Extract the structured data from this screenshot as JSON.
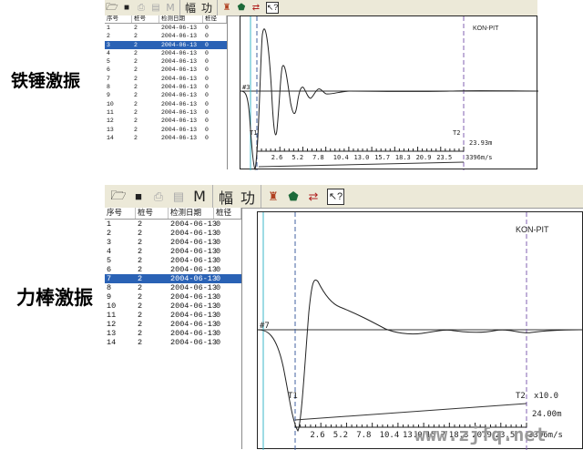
{
  "panels": [
    {
      "caption": "铁锤激振",
      "toolbar": {
        "open_icon": "open-folder-icon",
        "save_icon": "save-disk-icon",
        "print_icon": "print-icon",
        "preview_icon": "print-preview-icon",
        "m_label": "M",
        "fu_label": "幅",
        "gong_label": "功",
        "tool1_icon": "figure-icon",
        "tool2_icon": "shield-icon",
        "tool3_icon": "arrows-icon",
        "help_icon": "help-pointer-icon"
      },
      "list": {
        "headers": [
          "序号",
          "桩号",
          "检测日期",
          "桩径"
        ],
        "rows": [
          [
            "1",
            "2",
            "2004-06-13",
            "0"
          ],
          [
            "2",
            "2",
            "2004-06-13",
            "0"
          ],
          [
            "3",
            "2",
            "2004-06-13",
            "0"
          ],
          [
            "4",
            "2",
            "2004-06-13",
            "0"
          ],
          [
            "5",
            "2",
            "2004-06-13",
            "0"
          ],
          [
            "6",
            "2",
            "2004-06-13",
            "0"
          ],
          [
            "7",
            "2",
            "2004-06-13",
            "0"
          ],
          [
            "8",
            "2",
            "2004-06-13",
            "0"
          ],
          [
            "9",
            "2",
            "2004-06-13",
            "0"
          ],
          [
            "10",
            "2",
            "2004-06-13",
            "0"
          ],
          [
            "11",
            "2",
            "2004-06-13",
            "0"
          ],
          [
            "12",
            "2",
            "2004-06-13",
            "0"
          ],
          [
            "13",
            "2",
            "2004-06-13",
            "0"
          ],
          [
            "14",
            "2",
            "2004-06-13",
            "0"
          ]
        ],
        "selected_index": 2
      },
      "plot": {
        "brand": "KON-PIT",
        "trace_label": "#3",
        "t1_label": "T1",
        "t2_label": "T2",
        "scale_label": "",
        "length_label": "23.93m",
        "ticks": [
          "2.6",
          "5.2",
          "7.8",
          "10.4",
          "13.0",
          "15.7",
          "18.3",
          "20.9",
          "23.5"
        ],
        "axis_unit": "3396m/s"
      }
    },
    {
      "caption": "力棒激振",
      "toolbar": {
        "open_icon": "open-folder-icon",
        "save_icon": "save-disk-icon",
        "print_icon": "print-icon",
        "preview_icon": "print-preview-icon",
        "m_label": "M",
        "fu_label": "幅",
        "gong_label": "功",
        "tool1_icon": "figure-icon",
        "tool2_icon": "shield-icon",
        "tool3_icon": "arrows-icon",
        "help_icon": "help-pointer-icon"
      },
      "list": {
        "headers": [
          "序号",
          "桩号",
          "检测日期",
          "桩径"
        ],
        "rows": [
          [
            "1",
            "2",
            "2004-06-13",
            "0"
          ],
          [
            "2",
            "2",
            "2004-06-13",
            "0"
          ],
          [
            "3",
            "2",
            "2004-06-13",
            "0"
          ],
          [
            "4",
            "2",
            "2004-06-13",
            "0"
          ],
          [
            "5",
            "2",
            "2004-06-13",
            "0"
          ],
          [
            "6",
            "2",
            "2004-06-13",
            "0"
          ],
          [
            "7",
            "2",
            "2004-06-13",
            "0"
          ],
          [
            "8",
            "2",
            "2004-06-13",
            "0"
          ],
          [
            "9",
            "2",
            "2004-06-13",
            "0"
          ],
          [
            "10",
            "2",
            "2004-06-13",
            "0"
          ],
          [
            "11",
            "2",
            "2004-06-13",
            "0"
          ],
          [
            "12",
            "2",
            "2004-06-13",
            "0"
          ],
          [
            "13",
            "2",
            "2004-06-13",
            "0"
          ],
          [
            "14",
            "2",
            "2004-06-13",
            "0"
          ]
        ],
        "selected_index": 6
      },
      "plot": {
        "brand": "KON-PIT",
        "trace_label": "#7",
        "t1_label": "T1",
        "t2_label": "T2",
        "scale_label": "x10.0",
        "length_label": "24.00m",
        "ticks": [
          "2.6",
          "5.2",
          "7.8",
          "10.4",
          "13.0",
          "15.7",
          "18.3",
          "20.9",
          "23.5"
        ],
        "axis_unit": "3396m/s"
      }
    }
  ],
  "watermark": "www.zjfq.net"
}
